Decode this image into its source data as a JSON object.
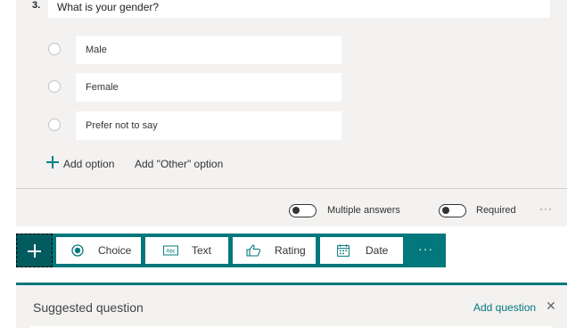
{
  "question": {
    "number": "3.",
    "title": "What is your gender?",
    "options": [
      {
        "label": "Male"
      },
      {
        "label": "Female"
      },
      {
        "label": "Prefer not to say"
      }
    ],
    "add_option": "Add option",
    "add_other": "Add \"Other\" option",
    "multiple_answers_label": "Multiple answers",
    "required_label": "Required",
    "more_label": "···"
  },
  "toolbar": {
    "buttons": [
      {
        "label": "Choice",
        "icon": "radio-icon"
      },
      {
        "label": "Text",
        "icon": "text-abc-icon"
      },
      {
        "label": "Rating",
        "icon": "thumbs-up-icon"
      },
      {
        "label": "Date",
        "icon": "calendar-icon"
      }
    ],
    "more_label": "···"
  },
  "suggested": {
    "title": "Suggested question",
    "add_question": "Add question",
    "close_glyph": "✕"
  },
  "colors": {
    "accent": "#03787c",
    "card_bg": "#f3f2f1"
  }
}
